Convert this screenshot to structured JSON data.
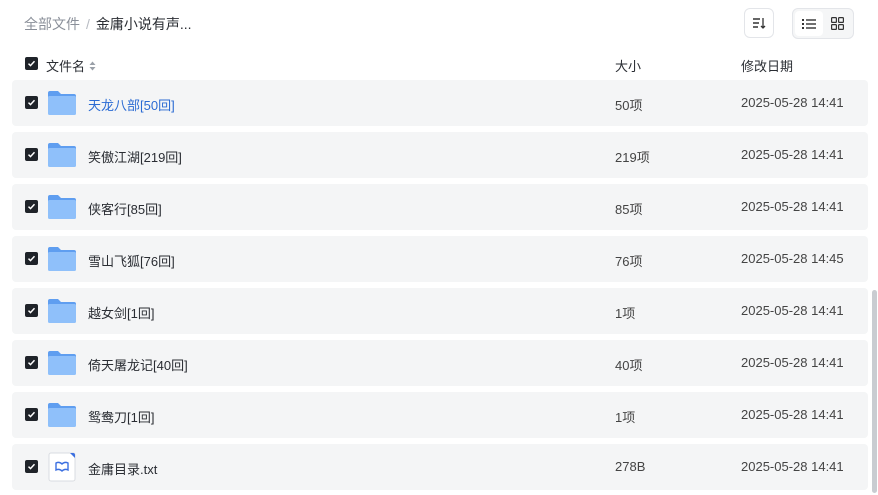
{
  "breadcrumb": {
    "root": "全部文件",
    "separator": "/",
    "current": "金庸小说有声..."
  },
  "columns": {
    "name": "文件名",
    "size": "大小",
    "date": "修改日期"
  },
  "toolbar": {
    "sort_icon": "sort-icon",
    "list_view_icon": "list-view-icon",
    "grid_view_icon": "grid-view-icon",
    "active_view": "list"
  },
  "colors": {
    "folder": "#7fb3f5",
    "link": "#2b6bd3",
    "row_bg": "#f4f5f6",
    "checkbox": "#1f2329"
  },
  "files": [
    {
      "name": "天龙八部[50回]",
      "size": "50项",
      "date": "2025-05-28 14:41",
      "type": "folder",
      "checked": true
    },
    {
      "name": "笑傲江湖[219回]",
      "size": "219项",
      "date": "2025-05-28 14:41",
      "type": "folder",
      "checked": true
    },
    {
      "name": "侠客行[85回]",
      "size": "85项",
      "date": "2025-05-28 14:41",
      "type": "folder",
      "checked": true
    },
    {
      "name": "雪山飞狐[76回]",
      "size": "76项",
      "date": "2025-05-28 14:45",
      "type": "folder",
      "checked": true
    },
    {
      "name": "越女剑[1回]",
      "size": "1项",
      "date": "2025-05-28 14:41",
      "type": "folder",
      "checked": true
    },
    {
      "name": "倚天屠龙记[40回]",
      "size": "40项",
      "date": "2025-05-28 14:41",
      "type": "folder",
      "checked": true
    },
    {
      "name": "鸳鸯刀[1回]",
      "size": "1项",
      "date": "2025-05-28 14:41",
      "type": "folder",
      "checked": true
    },
    {
      "name": "金庸目录.txt",
      "size": "278B",
      "date": "2025-05-28 14:41",
      "type": "txt",
      "checked": true
    }
  ]
}
